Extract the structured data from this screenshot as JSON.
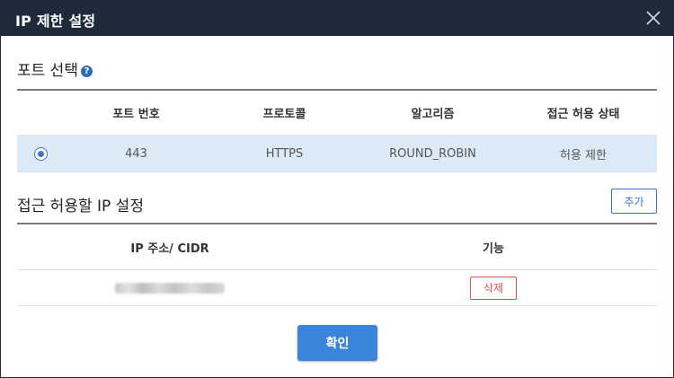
{
  "dialog": {
    "title": "IP 제한 설정",
    "close_icon": "close-icon"
  },
  "port_section": {
    "title": "포트 선택",
    "help_icon": "?",
    "columns": [
      "포트 번호",
      "프로토콜",
      "알고리즘",
      "접근 허용 상태"
    ],
    "rows": [
      {
        "selected": true,
        "port": "443",
        "protocol": "HTTPS",
        "algorithm": "ROUND_ROBIN",
        "status": "허용 제한"
      }
    ]
  },
  "ip_section": {
    "title": "접근 허용할 IP 설정",
    "add_label": "추가",
    "columns": [
      "IP 주소/ CIDR",
      "기능"
    ],
    "rows": [
      {
        "ip": "",
        "delete_label": "삭제"
      }
    ]
  },
  "footer": {
    "confirm_label": "확인"
  },
  "colors": {
    "titlebar": "#1f2b3a",
    "accent": "#3876c8",
    "selected_row": "#dceaf6",
    "danger": "#d9534f",
    "confirm": "#3b84dc"
  }
}
